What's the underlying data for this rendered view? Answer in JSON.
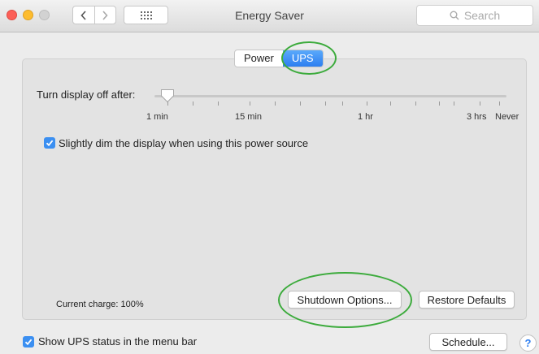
{
  "window": {
    "title": "Energy Saver",
    "search_placeholder": "Search",
    "buttons": {
      "back": "back",
      "forward": "forward",
      "show_all": "show-all"
    }
  },
  "tabs": [
    {
      "label": "Power",
      "selected": false
    },
    {
      "label": "UPS",
      "selected": true
    }
  ],
  "display_sleep": {
    "label": "Turn display off after:",
    "tick_labels": [
      "1 min",
      "15 min",
      "1 hr",
      "3 hrs",
      "Never"
    ],
    "selected_value": "1 min"
  },
  "dim_checkbox": {
    "label": "Slightly dim the display when using this power source",
    "checked": true
  },
  "current_charge": "Current charge: 100%",
  "buttons": {
    "shutdown_options": "Shutdown Options...",
    "restore_defaults": "Restore Defaults",
    "schedule": "Schedule...",
    "help": "?"
  },
  "ups_status_checkbox": {
    "label": "Show UPS status in the menu bar",
    "checked": true
  },
  "colors": {
    "accent": "#2d7ef0",
    "annotation_circle": "#3cab3c"
  }
}
